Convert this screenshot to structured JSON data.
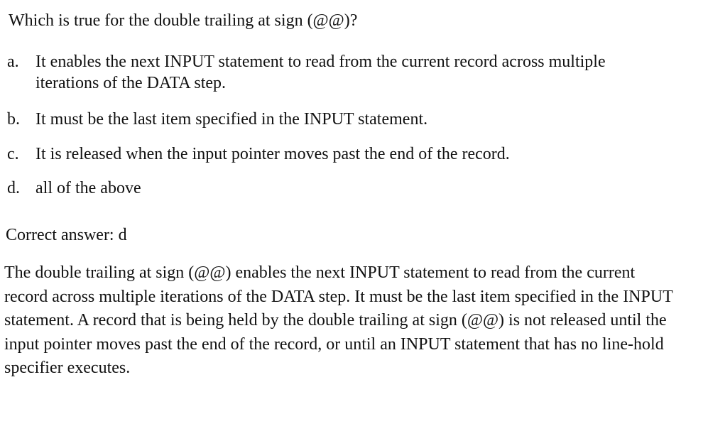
{
  "question": "Which is true for the double trailing at sign (@@)?",
  "options": [
    {
      "letter": "a.",
      "text": "It enables the next INPUT statement to read from the current record across multiple iterations of the DATA step."
    },
    {
      "letter": "b.",
      "text": "It must be the last item specified in the INPUT statement."
    },
    {
      "letter": "c.",
      "text": "It is released when the input pointer moves past the end of the record."
    },
    {
      "letter": "d.",
      "text": "all of the above"
    }
  ],
  "answer": "Correct answer: d",
  "explanation": "The double trailing at sign (@@) enables the next INPUT statement to read from the current record across multiple iterations of the DATA step. It must be the last item specified in the INPUT statement. A record that is being held by the double trailing at sign (@@) is not released until the input pointer moves past the end of the record, or until an INPUT statement that has no line-hold specifier executes."
}
